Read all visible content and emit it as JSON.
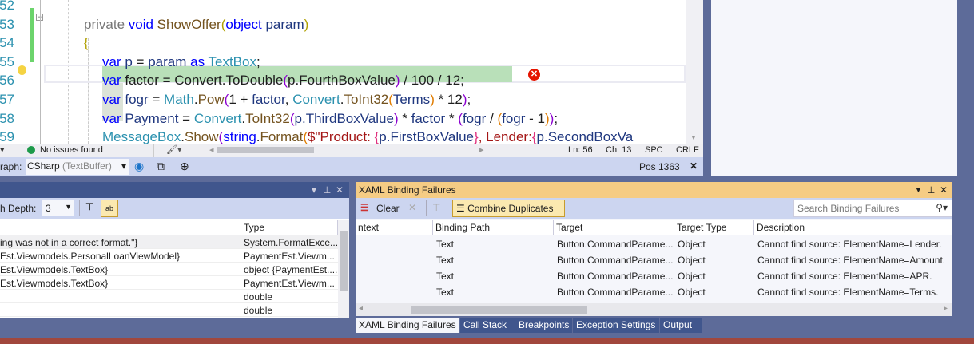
{
  "editor": {
    "line_numbers": [
      "52",
      "53",
      "54",
      "55",
      "56",
      "57",
      "58",
      "59"
    ],
    "lines": [
      [],
      [
        [
          "private ",
          "fa"
        ],
        [
          "void ",
          "kw"
        ],
        [
          "ShowOffer",
          "me"
        ],
        [
          "(",
          "b1"
        ],
        [
          "object ",
          "kw"
        ],
        [
          "param",
          "va"
        ],
        [
          ")",
          "b1"
        ]
      ],
      [
        [
          "{",
          "b1"
        ]
      ],
      [
        [
          "var ",
          "kw"
        ],
        [
          "p ",
          "va"
        ],
        [
          "= ",
          "pl"
        ],
        [
          "param ",
          "va"
        ],
        [
          "as ",
          "kw"
        ],
        [
          "TextBox",
          "ty"
        ],
        [
          ";",
          "pl"
        ]
      ],
      [
        [
          "var ",
          "kw"
        ],
        [
          "factor ",
          "pl"
        ],
        [
          "= ",
          "pl"
        ],
        [
          "Convert",
          "pl"
        ],
        [
          ".",
          "pl"
        ],
        [
          "ToDouble",
          "pl"
        ],
        [
          "(",
          "b2"
        ],
        [
          "p",
          "pl"
        ],
        [
          ".FourthBoxValue",
          "pl"
        ],
        [
          ")",
          "b2"
        ],
        [
          " / 100 / 12;",
          "pl"
        ]
      ],
      [
        [
          "var ",
          "kw"
        ],
        [
          "fogr ",
          "va"
        ],
        [
          "= ",
          "pl"
        ],
        [
          "Math",
          "ty"
        ],
        [
          ".",
          "pl"
        ],
        [
          "Pow",
          "me"
        ],
        [
          "(",
          "b2"
        ],
        [
          "1 + ",
          "pl"
        ],
        [
          "factor",
          "va"
        ],
        [
          ", ",
          "pl"
        ],
        [
          "Convert",
          "ty"
        ],
        [
          ".",
          "pl"
        ],
        [
          "ToInt32",
          "me"
        ],
        [
          "(",
          "b3"
        ],
        [
          "Terms",
          "va"
        ],
        [
          ")",
          "b3"
        ],
        [
          " * 12",
          "pl"
        ],
        [
          ")",
          "b2"
        ],
        [
          ";",
          "pl"
        ]
      ],
      [
        [
          "var ",
          "kw"
        ],
        [
          "Payment ",
          "va"
        ],
        [
          "= ",
          "pl"
        ],
        [
          "Convert",
          "ty"
        ],
        [
          ".",
          "pl"
        ],
        [
          "ToInt32",
          "me"
        ],
        [
          "(",
          "b2"
        ],
        [
          "p",
          "va"
        ],
        [
          ".ThirdBoxValue",
          "va"
        ],
        [
          ")",
          "b2"
        ],
        [
          " * ",
          "pl"
        ],
        [
          "factor",
          "va"
        ],
        [
          " * ",
          "pl"
        ],
        [
          "(",
          "b2"
        ],
        [
          "fogr ",
          "va"
        ],
        [
          "/ ",
          "pl"
        ],
        [
          "(",
          "b3"
        ],
        [
          "fogr ",
          "va"
        ],
        [
          "- 1",
          "pl"
        ],
        [
          ")",
          "b3"
        ],
        [
          ")",
          "b2"
        ],
        [
          ";",
          "pl"
        ]
      ],
      [
        [
          "MessageBox",
          "ty"
        ],
        [
          ".",
          "pl"
        ],
        [
          "Show",
          "me"
        ],
        [
          "(",
          "b2"
        ],
        [
          "string",
          "kw"
        ],
        [
          ".",
          "pl"
        ],
        [
          "Format",
          "me"
        ],
        [
          "(",
          "b3"
        ],
        [
          "$\"Product: ",
          "st"
        ],
        [
          "{",
          "in"
        ],
        [
          "p",
          "va"
        ],
        [
          ".FirstBoxValue",
          "va"
        ],
        [
          "}",
          "in"
        ],
        [
          ", Lender:",
          "st"
        ],
        [
          "{",
          "in"
        ],
        [
          "p",
          "va"
        ],
        [
          ".SecondBoxVa",
          "va"
        ]
      ]
    ]
  },
  "status": {
    "issues": "No issues found",
    "ln": "Ln: 56",
    "ch": "Ch: 13",
    "spc": "SPC",
    "crlf": "CRLF"
  },
  "navbar": {
    "label": "raph:",
    "combo_main": "CSharp",
    "combo_sub": "(TextBuffer)",
    "pos": "Pos 1363",
    "close": "✕"
  },
  "locals": {
    "depth_label": "h Depth:",
    "depth_value": "3",
    "columns": [
      "",
      "Type"
    ],
    "rows": [
      [
        "ing was not in a correct format.\"}",
        "System.FormatExce..."
      ],
      [
        "Est.Viewmodels.PersonalLoanViewModel}",
        "PaymentEst.Viewm..."
      ],
      [
        "Est.Viewmodels.TextBox}",
        "object {PaymentEst...."
      ],
      [
        "Est.Viewmodels.TextBox}",
        "PaymentEst.Viewm..."
      ],
      [
        "",
        "double"
      ],
      [
        "",
        "double"
      ]
    ]
  },
  "xaml": {
    "title": "XAML Binding Failures",
    "clear": "Clear",
    "combine": "Combine Duplicates",
    "search_placeholder": "Search Binding Failures",
    "columns": [
      "ntext",
      "Binding Path",
      "Target",
      "Target Type",
      "Description"
    ],
    "rows": [
      [
        "",
        "Text",
        "Button.CommandParame...",
        "Object",
        "Cannot find source: ElementName=Lender."
      ],
      [
        "",
        "Text",
        "Button.CommandParame...",
        "Object",
        "Cannot find source: ElementName=Amount."
      ],
      [
        "",
        "Text",
        "Button.CommandParame...",
        "Object",
        "Cannot find source: ElementName=APR."
      ],
      [
        "",
        "Text",
        "Button.CommandParame...",
        "Object",
        "Cannot find source: ElementName=Terms."
      ]
    ],
    "tabs": [
      "XAML Binding Failures",
      "Call Stack",
      "Breakpoints",
      "Exception Settings",
      "Output"
    ]
  },
  "colors": {
    "accent": "#5d6b99",
    "active_title": "#f5cc84",
    "error": "#e51400",
    "statusbar": "#a1473d"
  }
}
